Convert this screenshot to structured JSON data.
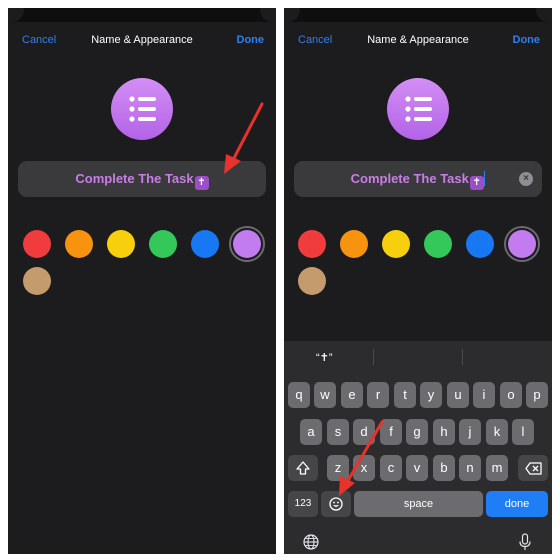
{
  "colors": {
    "accent": "#2f7ff4",
    "list_icon": "#c97de8",
    "swatches": [
      "#f03c3c",
      "#f7930e",
      "#f7cf0c",
      "#34c759",
      "#1877f2",
      "#c27cf0",
      "#c49b6c"
    ],
    "annotation_arrow": "#e8322a"
  },
  "left_screen": {
    "nav": {
      "cancel": "Cancel",
      "title": "Name & Appearance",
      "done": "Done"
    },
    "icon": "list-bullet-icon",
    "name_field": {
      "value": "Complete The Task",
      "emoji": "✝"
    },
    "selected_swatch": 5
  },
  "right_screen": {
    "nav": {
      "cancel": "Cancel",
      "title": "Name & Appearance",
      "done": "Done"
    },
    "icon": "list-bullet-icon",
    "name_field": {
      "value": "Complete The Task",
      "emoji": "✝",
      "clear_icon": "clear-x-icon"
    },
    "selected_swatch": 5,
    "keyboard": {
      "suggestions": [
        "“✝”",
        "",
        ""
      ],
      "row1": [
        "q",
        "w",
        "e",
        "r",
        "t",
        "y",
        "u",
        "i",
        "o",
        "p"
      ],
      "row2": [
        "a",
        "s",
        "d",
        "f",
        "g",
        "h",
        "j",
        "k",
        "l"
      ],
      "row3": [
        "z",
        "x",
        "c",
        "v",
        "b",
        "n",
        "m"
      ],
      "shift_icon": "shift-arrow-icon",
      "backspace_icon": "backspace-icon",
      "numbers_label": "123",
      "emoji_icon": "emoji-face-icon",
      "space_label": "space",
      "done_label": "done",
      "globe_icon": "globe-icon",
      "mic_icon": "microphone-icon"
    }
  }
}
